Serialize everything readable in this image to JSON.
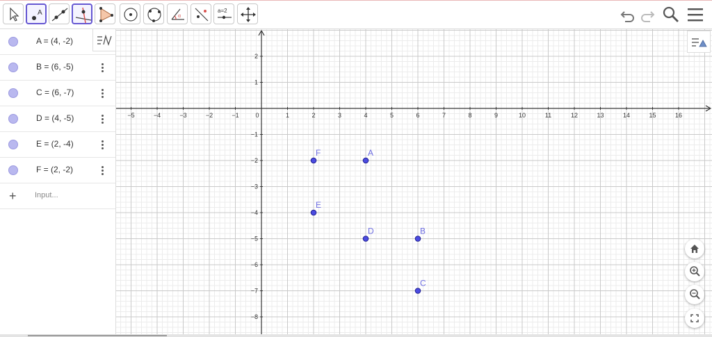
{
  "toolbar": {
    "tools": [
      {
        "name": "move-tool-icon",
        "active": false
      },
      {
        "name": "point-tool-icon",
        "active": true
      },
      {
        "name": "line-tool-icon",
        "active": false
      },
      {
        "name": "perpendicular-line-tool-icon",
        "active": true
      },
      {
        "name": "polygon-tool-icon",
        "active": false
      },
      {
        "name": "circle-center-point-tool-icon",
        "active": false
      },
      {
        "name": "circle-three-points-tool-icon",
        "active": false
      },
      {
        "name": "angle-tool-icon",
        "active": false
      },
      {
        "name": "reflect-tool-icon",
        "active": false
      },
      {
        "name": "slider-tool-icon",
        "active": false
      },
      {
        "name": "move-graphics-view-tool-icon",
        "active": false
      }
    ],
    "point_tool_letter": "A",
    "slider_text": "a=2",
    "right_icons": [
      "undo-icon",
      "redo-icon",
      "search-icon",
      "menu-icon"
    ]
  },
  "algebra": {
    "items": [
      {
        "label": "A = (4, -2)"
      },
      {
        "label": "B = (6, -5)"
      },
      {
        "label": "C = (6, -7)"
      },
      {
        "label": "D = (4, -5)"
      },
      {
        "label": "E = (2, -4)"
      },
      {
        "label": "F = (2, -2)"
      }
    ],
    "input_placeholder": "Input..."
  },
  "graphics": {
    "x_ticks": [
      "−5",
      "−4",
      "−3",
      "−2",
      "−1",
      "0",
      "1",
      "2",
      "3",
      "4",
      "5",
      "6",
      "7",
      "8",
      "9",
      "10",
      "11",
      "12",
      "13",
      "14",
      "15",
      "16"
    ],
    "y_ticks": [
      "2",
      "1",
      "−1",
      "−2",
      "−3",
      "−4",
      "−5",
      "−6",
      "−7",
      "−8"
    ],
    "points": [
      {
        "name": "A",
        "x": 4,
        "y": -2
      },
      {
        "name": "B",
        "x": 6,
        "y": -5
      },
      {
        "name": "C",
        "x": 6,
        "y": -7
      },
      {
        "name": "D",
        "x": 4,
        "y": -5
      },
      {
        "name": "E",
        "x": 2,
        "y": -4
      },
      {
        "name": "F",
        "x": 2,
        "y": -2
      }
    ],
    "point_color": "#4b4be0",
    "label_color": "#6b6be0",
    "zoom_buttons": [
      "home-icon",
      "zoom-in-icon",
      "zoom-out-icon",
      "fullscreen-icon"
    ]
  },
  "colors": {
    "accent": "#6557d2",
    "point_fill": "#b9b8ef"
  }
}
